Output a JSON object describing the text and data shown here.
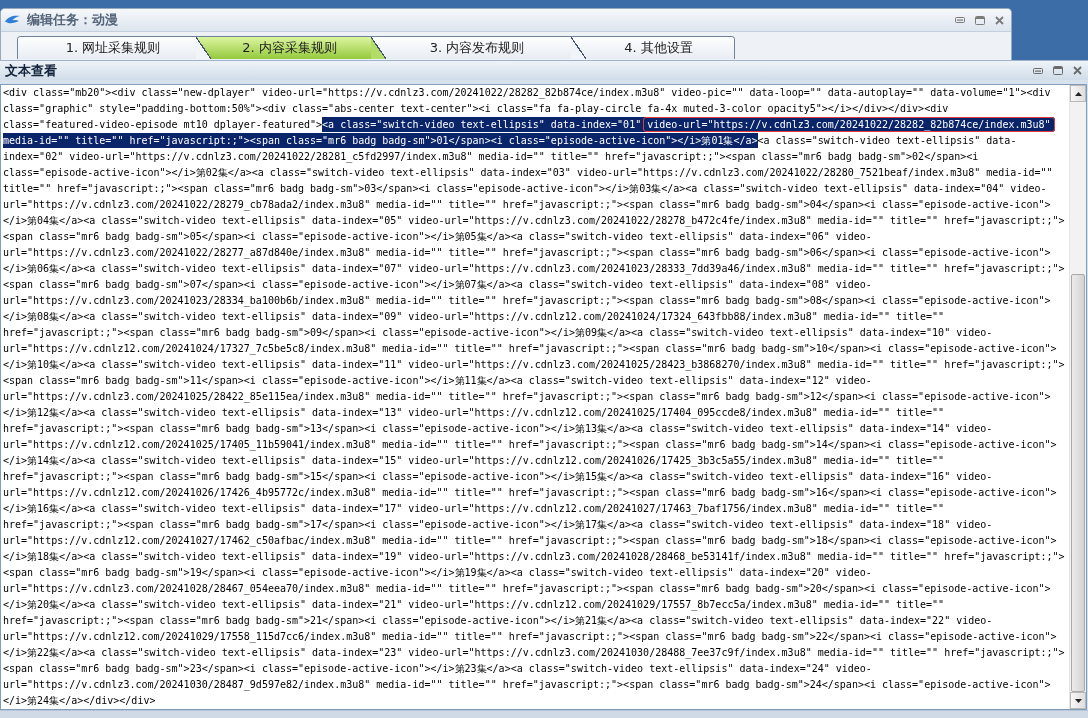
{
  "background_window": {
    "title": "编辑任务：动漫",
    "tabs": [
      {
        "label": "1. 网址采集规则",
        "selected": false
      },
      {
        "label": "2. 内容采集规则",
        "selected": true
      },
      {
        "label": "3. 内容发布规则",
        "selected": false
      },
      {
        "label": "4. 其他设置",
        "selected": false
      }
    ]
  },
  "text_window": {
    "title": "文本查看",
    "lines": [
      [
        {
          "text": "<div class=\"mb20\"><div class=\"new-dplayer\" video-url=\"https://v.cdnlz3.com/20241022/28282_82b874ce/index.m3u8\" video-pic=\"\" data-loop=\"\" data-autoplay=\"\" data-volume=\"1\"><div",
          "selected": false,
          "framed": false
        }
      ],
      [
        {
          "text": "class=\"graphic\" style=\"padding-bottom:50%\"><div class=\"abs-center text-center\"><i class=\"fa fa-play-circle fa-4x muted-3-color opacity5\"></i></div></div><div",
          "selected": false,
          "framed": false
        }
      ],
      [
        {
          "text": "class=\"featured-video-episode mt10 dplayer-featured\">",
          "selected": false,
          "framed": false
        },
        {
          "text": "<a class=\"switch-video text-ellipsis\" data-index=\"01\" ",
          "selected": true,
          "framed": false
        },
        {
          "text": "video-url=\"https://v.cdnlz3.com/20241022/28282_82b874ce/index.m3u8\"",
          "selected": true,
          "framed": true
        }
      ],
      [
        {
          "text": "media-id=\"\" title=\"\" href=\"javascript:;\"><span class=\"mr6 badg badg-sm\">01</span><i class=\"episode-active-icon\"></i>第01集</a>",
          "selected": true,
          "framed": false
        },
        {
          "text": "<a class=\"switch-video text-ellipsis\" data-",
          "selected": false,
          "framed": false
        }
      ],
      [
        {
          "text": "index=\"02\" video-url=\"https://v.cdnlz3.com/20241022/28281_c5fd2997/index.m3u8\" media-id=\"\" title=\"\" href=\"javascript:;\"><span class=\"mr6 badg badg-sm\">02</span><i",
          "selected": false,
          "framed": false
        }
      ],
      [
        {
          "text": "class=\"episode-active-icon\"></i>第02集</a><a class=\"switch-video text-ellipsis\" data-index=\"03\" video-url=\"https://v.cdnlz3.com/20241022/28280_7521beaf/index.m3u8\" media-id=\"\"",
          "selected": false,
          "framed": false
        }
      ],
      [
        {
          "text": "title=\"\" href=\"javascript:;\"><span class=\"mr6 badg badg-sm\">03</span><i class=\"episode-active-icon\"></i>第03集</a><a class=\"switch-video text-ellipsis\" data-index=\"04\" video-",
          "selected": false,
          "framed": false
        }
      ],
      [
        {
          "text": "url=\"https://v.cdnlz3.com/20241022/28279_cb78ada2/index.m3u8\" media-id=\"\" title=\"\" href=\"javascript:;\"><span class=\"mr6 badg badg-sm\">04</span><i class=\"episode-active-icon\">",
          "selected": false,
          "framed": false
        }
      ],
      [
        {
          "text": "</i>第04集</a><a class=\"switch-video text-ellipsis\" data-index=\"05\" video-url=\"https://v.cdnlz3.com/20241022/28278_b472c4fe/index.m3u8\" media-id=\"\" title=\"\" href=\"javascript:;\">",
          "selected": false,
          "framed": false
        }
      ],
      [
        {
          "text": "<span class=\"mr6 badg badg-sm\">05</span><i class=\"episode-active-icon\"></i>第05集</a><a class=\"switch-video text-ellipsis\" data-index=\"06\" video-",
          "selected": false,
          "framed": false
        }
      ],
      [
        {
          "text": "url=\"https://v.cdnlz3.com/20241022/28277_a87d840e/index.m3u8\" media-id=\"\" title=\"\" href=\"javascript:;\"><span class=\"mr6 badg badg-sm\">06</span><i class=\"episode-active-icon\">",
          "selected": false,
          "framed": false
        }
      ],
      [
        {
          "text": "</i>第06集</a><a class=\"switch-video text-ellipsis\" data-index=\"07\" video-url=\"https://v.cdnlz3.com/20241023/28333_7dd39a46/index.m3u8\" media-id=\"\" title=\"\" href=\"javascript:;\">",
          "selected": false,
          "framed": false
        }
      ],
      [
        {
          "text": "<span class=\"mr6 badg badg-sm\">07</span><i class=\"episode-active-icon\"></i>第07集</a><a class=\"switch-video text-ellipsis\" data-index=\"08\" video-",
          "selected": false,
          "framed": false
        }
      ],
      [
        {
          "text": "url=\"https://v.cdnlz3.com/20241023/28334_ba100b6b/index.m3u8\" media-id=\"\" title=\"\" href=\"javascript:;\"><span class=\"mr6 badg badg-sm\">08</span><i class=\"episode-active-icon\">",
          "selected": false,
          "framed": false
        }
      ],
      [
        {
          "text": "</i>第08集</a><a class=\"switch-video text-ellipsis\" data-index=\"09\" video-url=\"https://v.cdnlz12.com/20241024/17324_643fbb88/index.m3u8\" media-id=\"\" title=\"\"",
          "selected": false,
          "framed": false
        }
      ],
      [
        {
          "text": "href=\"javascript:;\"><span class=\"mr6 badg badg-sm\">09</span><i class=\"episode-active-icon\"></i>第09集</a><a class=\"switch-video text-ellipsis\" data-index=\"10\" video-",
          "selected": false,
          "framed": false
        }
      ],
      [
        {
          "text": "url=\"https://v.cdnlz12.com/20241024/17327_7c5be5c8/index.m3u8\" media-id=\"\" title=\"\" href=\"javascript:;\"><span class=\"mr6 badg badg-sm\">10</span><i class=\"episode-active-icon\">",
          "selected": false,
          "framed": false
        }
      ],
      [
        {
          "text": "</i>第10集</a><a class=\"switch-video text-ellipsis\" data-index=\"11\" video-url=\"https://v.cdnlz3.com/20241025/28423_b3868270/index.m3u8\" media-id=\"\" title=\"\" href=\"javascript:;\">",
          "selected": false,
          "framed": false
        }
      ],
      [
        {
          "text": "<span class=\"mr6 badg badg-sm\">11</span><i class=\"episode-active-icon\"></i>第11集</a><a class=\"switch-video text-ellipsis\" data-index=\"12\" video-",
          "selected": false,
          "framed": false
        }
      ],
      [
        {
          "text": "url=\"https://v.cdnlz3.com/20241025/28422_85e115ea/index.m3u8\" media-id=\"\" title=\"\" href=\"javascript:;\"><span class=\"mr6 badg badg-sm\">12</span><i class=\"episode-active-icon\">",
          "selected": false,
          "framed": false
        }
      ],
      [
        {
          "text": "</i>第12集</a><a class=\"switch-video text-ellipsis\" data-index=\"13\" video-url=\"https://v.cdnlz12.com/20241025/17404_095ccde8/index.m3u8\" media-id=\"\" title=\"\"",
          "selected": false,
          "framed": false
        }
      ],
      [
        {
          "text": "href=\"javascript:;\"><span class=\"mr6 badg badg-sm\">13</span><i class=\"episode-active-icon\"></i>第13集</a><a class=\"switch-video text-ellipsis\" data-index=\"14\" video-",
          "selected": false,
          "framed": false
        }
      ],
      [
        {
          "text": "url=\"https://v.cdnlz12.com/20241025/17405_11b59041/index.m3u8\" media-id=\"\" title=\"\" href=\"javascript:;\"><span class=\"mr6 badg badg-sm\">14</span><i class=\"episode-active-icon\">",
          "selected": false,
          "framed": false
        }
      ],
      [
        {
          "text": "</i>第14集</a><a class=\"switch-video text-ellipsis\" data-index=\"15\" video-url=\"https://v.cdnlz12.com/20241026/17425_3b3c5a55/index.m3u8\" media-id=\"\" title=\"\"",
          "selected": false,
          "framed": false
        }
      ],
      [
        {
          "text": "href=\"javascript:;\"><span class=\"mr6 badg badg-sm\">15</span><i class=\"episode-active-icon\"></i>第15集</a><a class=\"switch-video text-ellipsis\" data-index=\"16\" video-",
          "selected": false,
          "framed": false
        }
      ],
      [
        {
          "text": "url=\"https://v.cdnlz12.com/20241026/17426_4b95772c/index.m3u8\" media-id=\"\" title=\"\" href=\"javascript:;\"><span class=\"mr6 badg badg-sm\">16</span><i class=\"episode-active-icon\">",
          "selected": false,
          "framed": false
        }
      ],
      [
        {
          "text": "</i>第16集</a><a class=\"switch-video text-ellipsis\" data-index=\"17\" video-url=\"https://v.cdnlz12.com/20241027/17463_7baf1756/index.m3u8\" media-id=\"\" title=\"\"",
          "selected": false,
          "framed": false
        }
      ],
      [
        {
          "text": "href=\"javascript:;\"><span class=\"mr6 badg badg-sm\">17</span><i class=\"episode-active-icon\"></i>第17集</a><a class=\"switch-video text-ellipsis\" data-index=\"18\" video-",
          "selected": false,
          "framed": false
        }
      ],
      [
        {
          "text": "url=\"https://v.cdnlz12.com/20241027/17462_c50afbac/index.m3u8\" media-id=\"\" title=\"\" href=\"javascript:;\"><span class=\"mr6 badg badg-sm\">18</span><i class=\"episode-active-icon\">",
          "selected": false,
          "framed": false
        }
      ],
      [
        {
          "text": "</i>第18集</a><a class=\"switch-video text-ellipsis\" data-index=\"19\" video-url=\"https://v.cdnlz3.com/20241028/28468_be53141f/index.m3u8\" media-id=\"\" title=\"\" href=\"javascript:;\">",
          "selected": false,
          "framed": false
        }
      ],
      [
        {
          "text": "<span class=\"mr6 badg badg-sm\">19</span><i class=\"episode-active-icon\"></i>第19集</a><a class=\"switch-video text-ellipsis\" data-index=\"20\" video-",
          "selected": false,
          "framed": false
        }
      ],
      [
        {
          "text": "url=\"https://v.cdnlz3.com/20241028/28467_054eea70/index.m3u8\" media-id=\"\" title=\"\" href=\"javascript:;\"><span class=\"mr6 badg badg-sm\">20</span><i class=\"episode-active-icon\">",
          "selected": false,
          "framed": false
        }
      ],
      [
        {
          "text": "</i>第20集</a><a class=\"switch-video text-ellipsis\" data-index=\"21\" video-url=\"https://v.cdnlz12.com/20241029/17557_8b7ecc5a/index.m3u8\" media-id=\"\" title=\"\"",
          "selected": false,
          "framed": false
        }
      ],
      [
        {
          "text": "href=\"javascript:;\"><span class=\"mr6 badg badg-sm\">21</span><i class=\"episode-active-icon\"></i>第21集</a><a class=\"switch-video text-ellipsis\" data-index=\"22\" video-",
          "selected": false,
          "framed": false
        }
      ],
      [
        {
          "text": "url=\"https://v.cdnlz12.com/20241029/17558_115d7cc6/index.m3u8\" media-id=\"\" title=\"\" href=\"javascript:;\"><span class=\"mr6 badg badg-sm\">22</span><i class=\"episode-active-icon\">",
          "selected": false,
          "framed": false
        }
      ],
      [
        {
          "text": "</i>第22集</a><a class=\"switch-video text-ellipsis\" data-index=\"23\" video-url=\"https://v.cdnlz3.com/20241030/28488_7ee37c9f/index.m3u8\" media-id=\"\" title=\"\" href=\"javascript:;\">",
          "selected": false,
          "framed": false
        }
      ],
      [
        {
          "text": "<span class=\"mr6 badg badg-sm\">23</span><i class=\"episode-active-icon\"></i>第23集</a><a class=\"switch-video text-ellipsis\" data-index=\"24\" video-",
          "selected": false,
          "framed": false
        }
      ],
      [
        {
          "text": "url=\"https://v.cdnlz3.com/20241030/28487_9d597e82/index.m3u8\" media-id=\"\" title=\"\" href=\"javascript:;\"><span class=\"mr6 badg badg-sm\">24</span><i class=\"episode-active-icon\">",
          "selected": false,
          "framed": false
        }
      ],
      [
        {
          "text": "</i>第24集</a></div></div>",
          "selected": false,
          "framed": false
        }
      ]
    ]
  }
}
